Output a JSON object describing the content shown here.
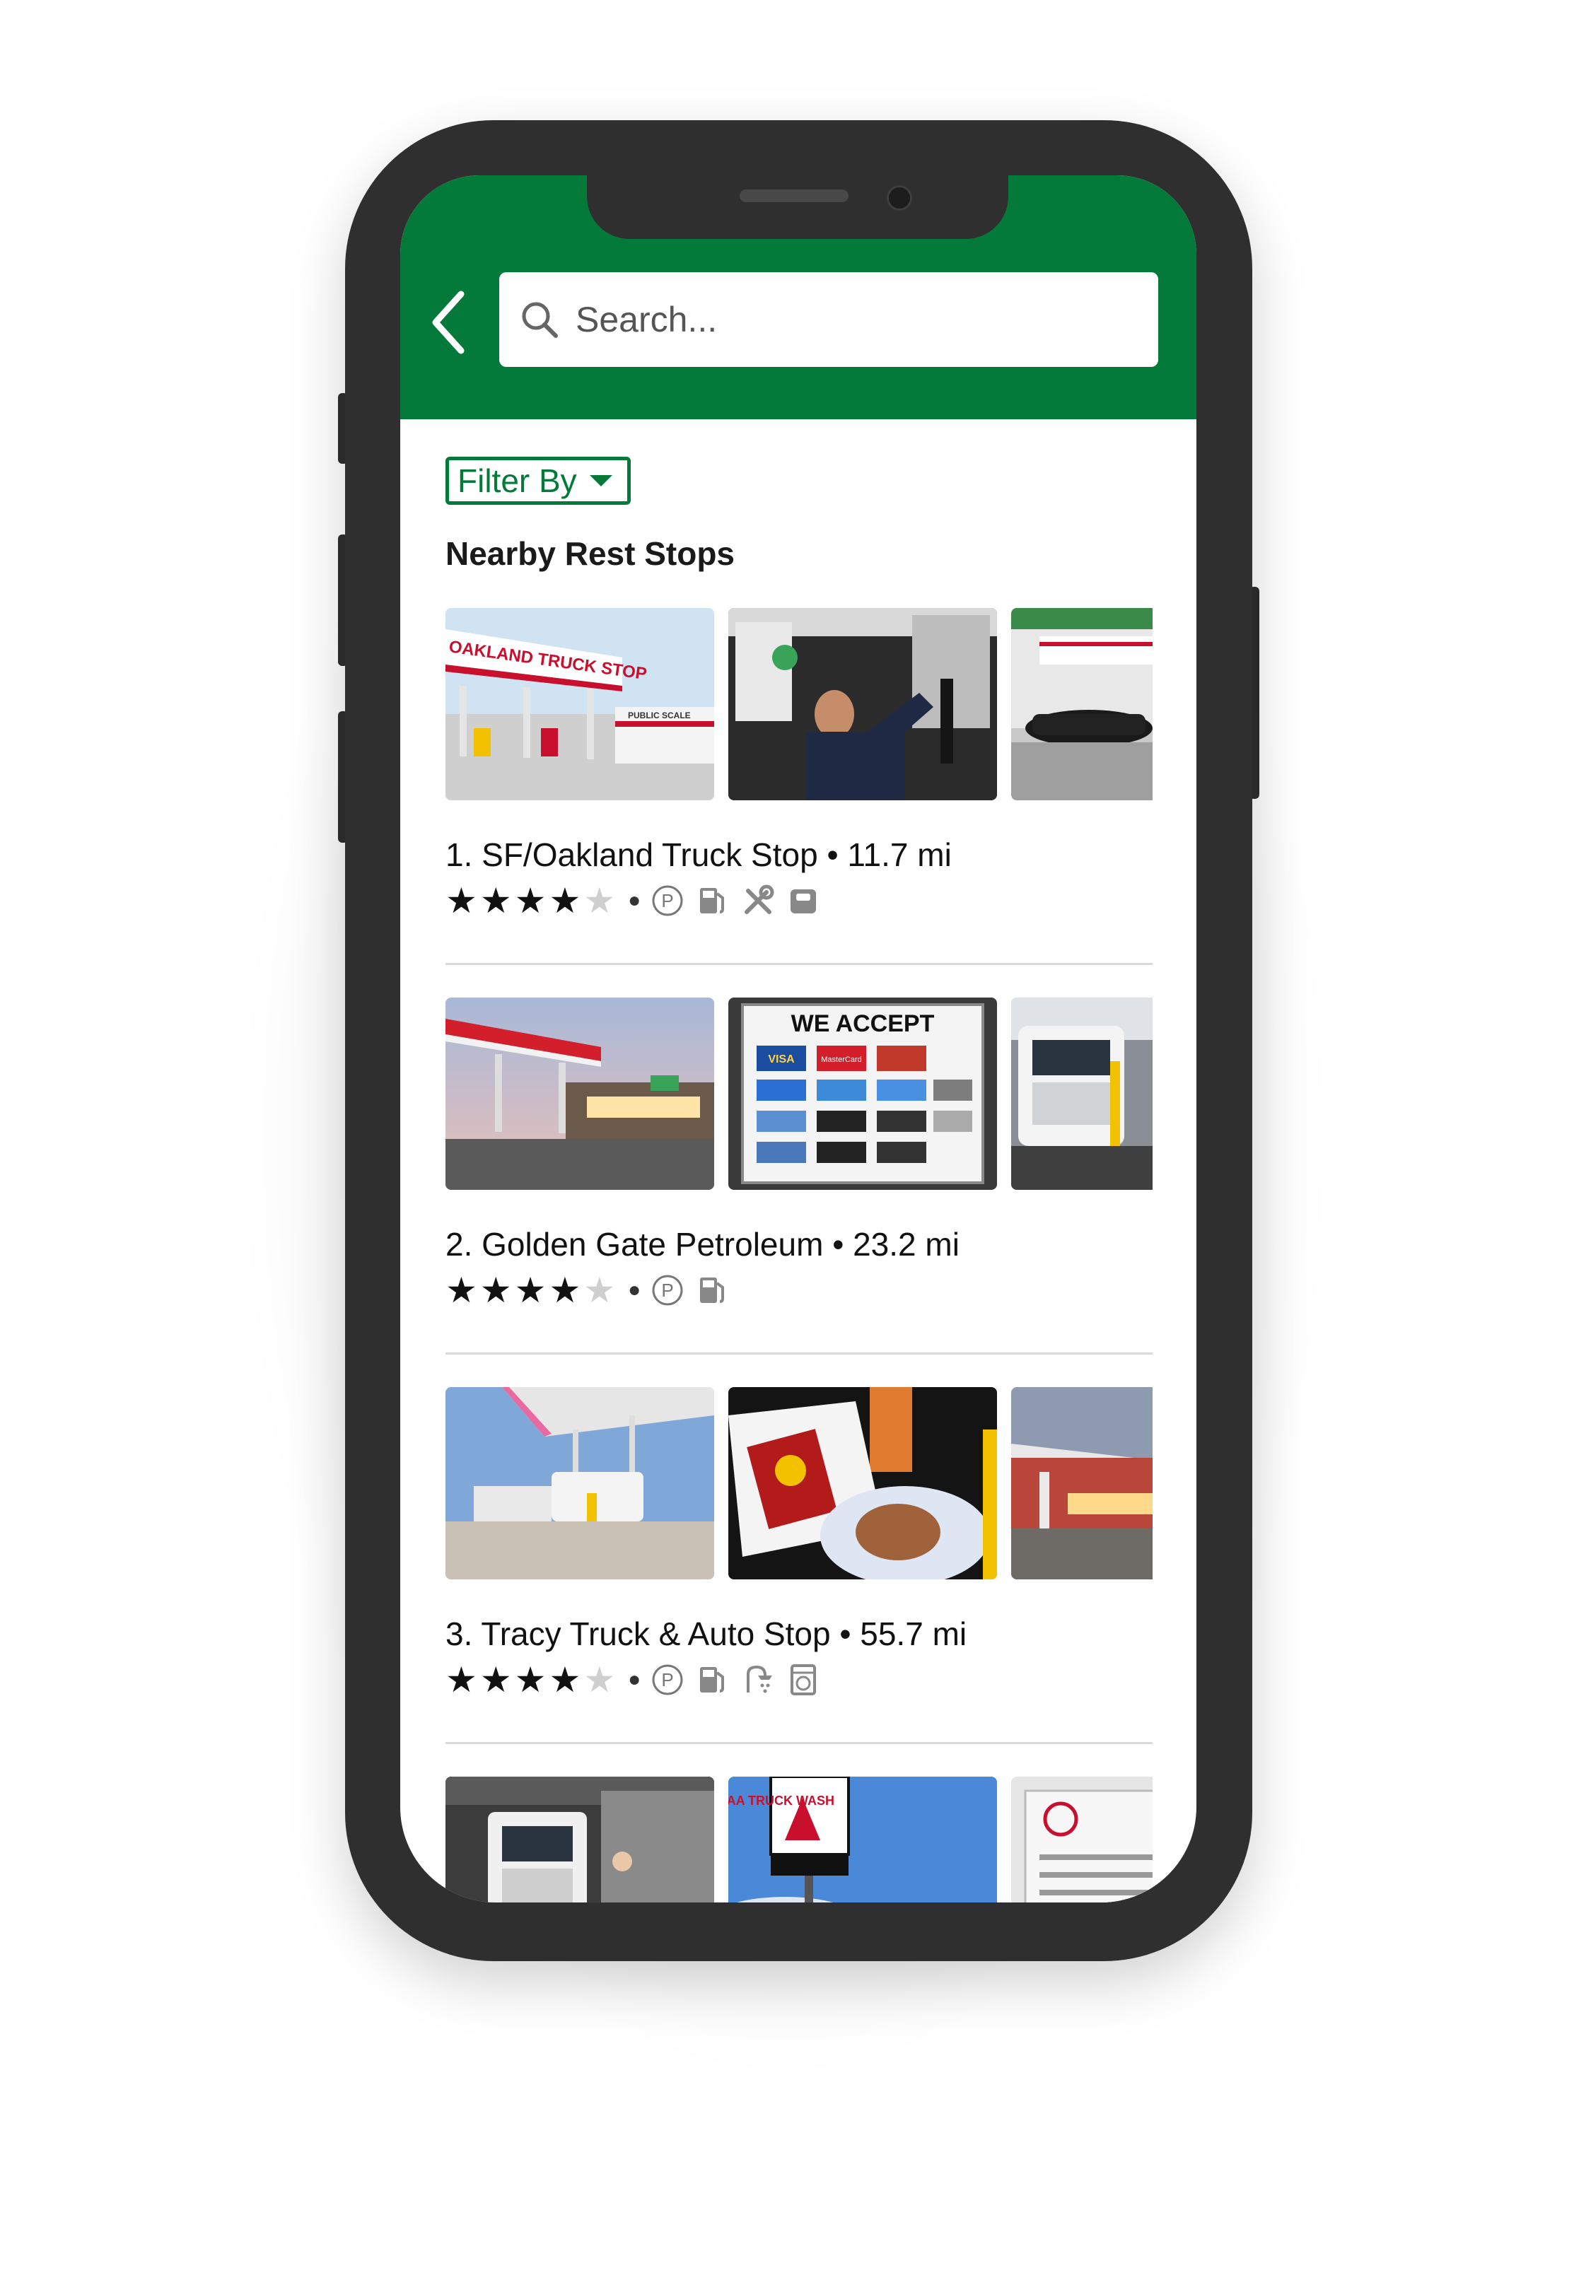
{
  "search": {
    "placeholder": "Search..."
  },
  "filter": {
    "label": "Filter By"
  },
  "section_title": "Nearby Rest Stops",
  "colors": {
    "brand_green": "#047a3a",
    "phone_frame": "#2f2f2f"
  },
  "stops": [
    {
      "title": "1. SF/Oakland Truck Stop • 11.7 mi",
      "rating": 4,
      "amenities": [
        "parking-icon",
        "fuel-icon",
        "repair-icon",
        "scale-icon"
      ],
      "photos": [
        "oakland-station-photo",
        "mechanic-photo",
        "public-scale-photo"
      ],
      "sign_texts": [
        "OAKLAND TRUCK STOP",
        "PUBLIC SCALE"
      ]
    },
    {
      "title": "2. Golden Gate Petroleum • 23.2 mi",
      "rating": 4,
      "amenities": [
        "parking-icon",
        "fuel-icon"
      ],
      "photos": [
        "gas-station-dusk-photo",
        "we-accept-cards-photo",
        "truck-front-photo"
      ],
      "sign_texts": [
        "WE ACCEPT",
        "VISA",
        "MasterCard"
      ]
    },
    {
      "title": "3. Tracy Truck & Auto Stop • 55.7 mi",
      "rating": 4,
      "amenities": [
        "parking-icon",
        "fuel-icon",
        "shower-icon",
        "laundry-icon"
      ],
      "photos": [
        "truck-fuel-lanes-photo",
        "food-plate-photo",
        "station-night-photo"
      ],
      "sign_texts": []
    },
    {
      "title": "",
      "rating": 0,
      "amenities": [],
      "photos": [
        "truck-wash-bay-photo",
        "truck-wash-sign-photo",
        "price-board-photo"
      ],
      "sign_texts": [
        "AA TRUCK WASH"
      ]
    }
  ]
}
